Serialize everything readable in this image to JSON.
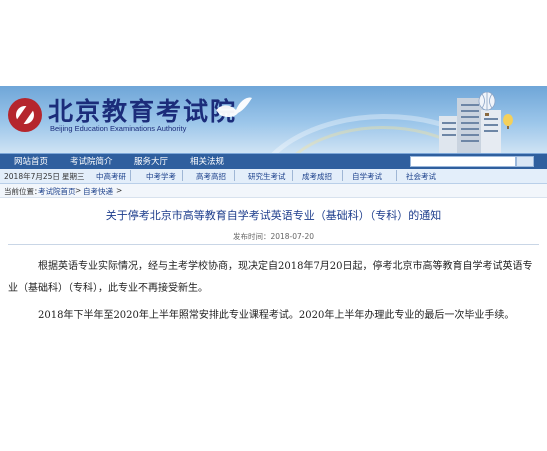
{
  "header": {
    "site_name_cn": "北京教育考试院",
    "site_name_en": "Beijing Education Examinations Authority"
  },
  "nav": {
    "items": [
      "网站首页",
      "考试院简介",
      "服务大厅",
      "相关法规"
    ],
    "search_placeholder": "",
    "search_button": ""
  },
  "subnav": {
    "date": "2018年7月25日",
    "weekday": "星期三",
    "links": [
      "中高考研",
      "中考学考",
      "高考高招",
      "研究生考试",
      "成考成招",
      "自学考试",
      "社会考试"
    ]
  },
  "breadcrumb": {
    "prefix": "当前位置：",
    "home": "考试院首页",
    "separator": ">",
    "current": "自考快递",
    "trailing": ">"
  },
  "article": {
    "title": "关于停考北京市高等教育自学考试英语专业（基础科）（专科）的通知",
    "publish_label": "发布时间：",
    "publish_date": "2018-07-20",
    "paragraph1": "根据英语专业实际情况，经与主考学校协商，现决定自2018年7月20日起，停考北京市高等教育自学考试英语专业（基础科）（专科），此专业不再接受新生。",
    "paragraph2": "2018年下半年至2020年上半年照常安排此专业课程考试。2020年上半年办理此专业的最后一次毕业手续。"
  }
}
